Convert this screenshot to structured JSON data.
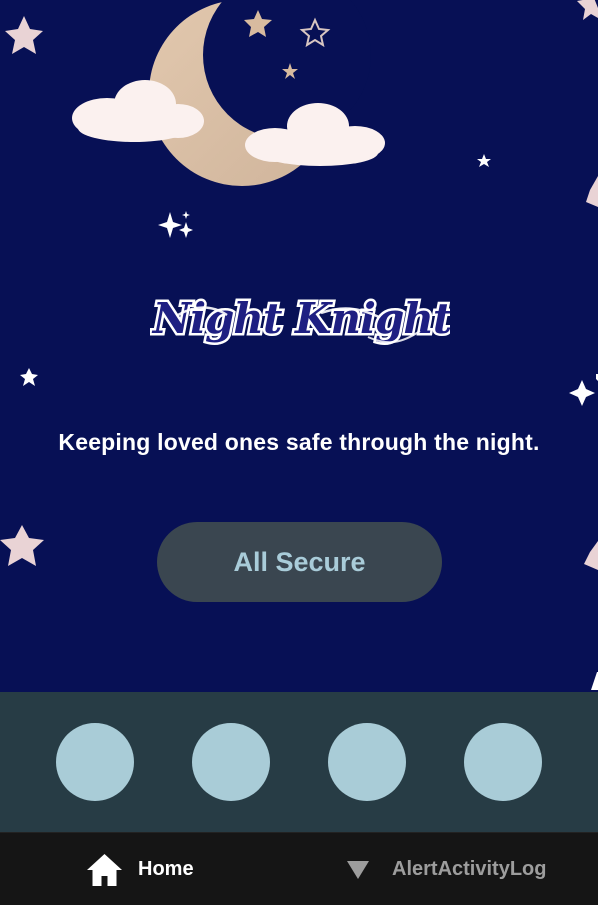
{
  "app": {
    "logo_text": "Night Knight",
    "tagline": "Keeping loved ones safe through the night.",
    "status_button_label": "All Secure"
  },
  "controls": {
    "circles": [
      {
        "name": "control-1"
      },
      {
        "name": "control-2"
      },
      {
        "name": "control-3"
      },
      {
        "name": "control-4"
      }
    ]
  },
  "nav": {
    "items": [
      {
        "label": "Home",
        "icon": "home-icon",
        "active": true
      },
      {
        "label": "AlertActivityLog",
        "icon": "triangle-down-icon",
        "active": false
      }
    ]
  },
  "colors": {
    "sky": "#071055",
    "button_bg": "#3a4650",
    "button_text": "#a9ccd9",
    "control_bg": "#273c45",
    "control_circle": "#a9ccd7",
    "nav_bg": "#151515"
  }
}
